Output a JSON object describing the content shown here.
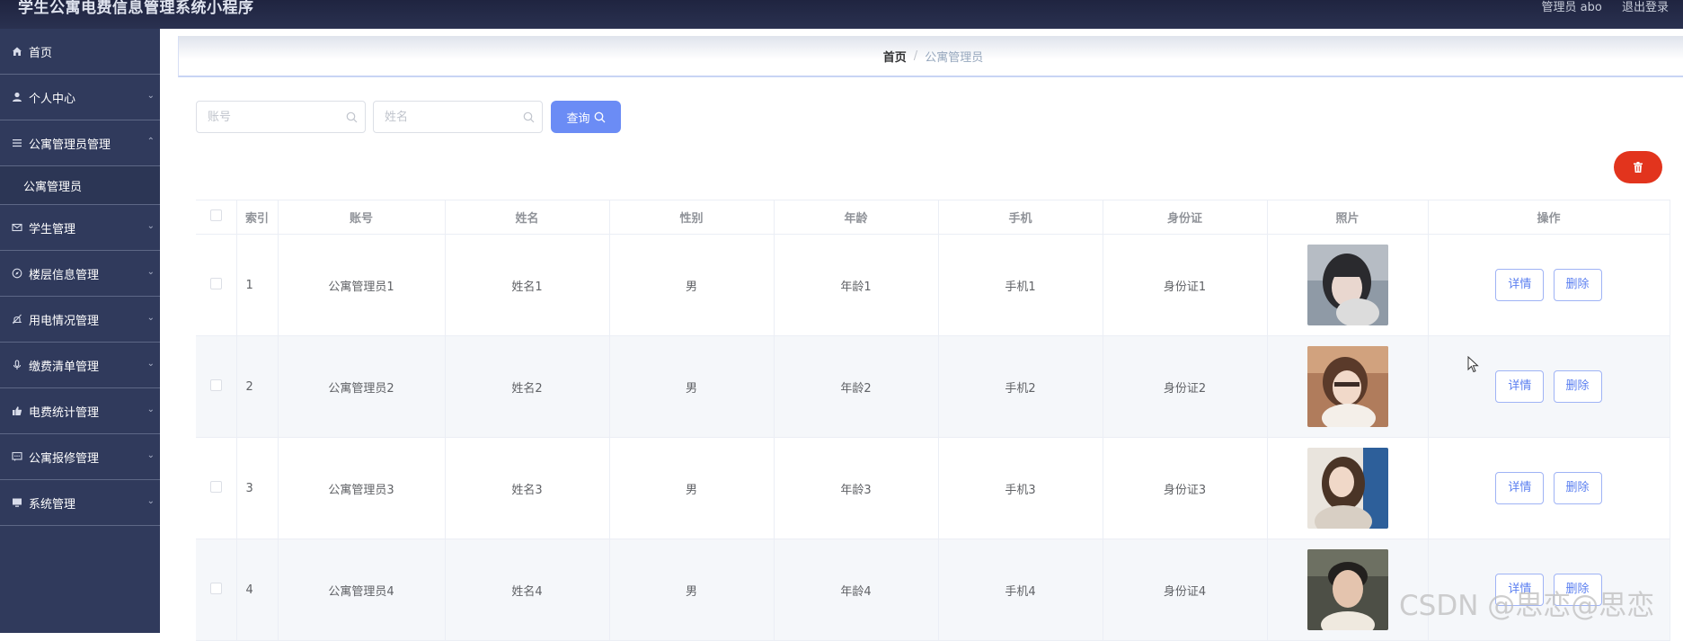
{
  "header": {
    "title": "学生公寓电费信息管理系统小程序",
    "user_label": "管理员 abo",
    "logout_label": "退出登录"
  },
  "sidebar": {
    "items": [
      {
        "label": "首页",
        "icon": "home-icon"
      },
      {
        "label": "个人中心",
        "icon": "user-icon"
      },
      {
        "label": "公寓管理员管理",
        "icon": "menu-icon",
        "sub": "公寓管理员"
      },
      {
        "label": "学生管理",
        "icon": "mail-icon"
      },
      {
        "label": "楼层信息管理",
        "icon": "compass-icon"
      },
      {
        "label": "用电情况管理",
        "icon": "bell-icon"
      },
      {
        "label": "缴费清单管理",
        "icon": "mic-icon"
      },
      {
        "label": "电费统计管理",
        "icon": "thumb-icon"
      },
      {
        "label": "公寓报修管理",
        "icon": "chat-icon"
      },
      {
        "label": "系统管理",
        "icon": "monitor-icon"
      }
    ]
  },
  "breadcrumb": {
    "home": "首页",
    "separator": "/",
    "current": "公寓管理员"
  },
  "search": {
    "account_placeholder": "账号",
    "name_placeholder": "姓名",
    "query_label": "查询"
  },
  "table": {
    "headers": [
      "索引",
      "账号",
      "姓名",
      "性别",
      "年龄",
      "手机",
      "身份证",
      "照片",
      "操作"
    ],
    "rows": [
      {
        "index": "1",
        "account": "公寓管理员1",
        "name": "姓名1",
        "gender": "男",
        "age": "年龄1",
        "phone": "手机1",
        "id_card": "身份证1"
      },
      {
        "index": "2",
        "account": "公寓管理员2",
        "name": "姓名2",
        "gender": "男",
        "age": "年龄2",
        "phone": "手机2",
        "id_card": "身份证2"
      },
      {
        "index": "3",
        "account": "公寓管理员3",
        "name": "姓名3",
        "gender": "男",
        "age": "年龄3",
        "phone": "手机3",
        "id_card": "身份证3"
      },
      {
        "index": "4",
        "account": "公寓管理员4",
        "name": "姓名4",
        "gender": "男",
        "age": "年龄4",
        "phone": "手机4",
        "id_card": "身份证4"
      }
    ],
    "detail_label": "详情",
    "delete_label": "删除"
  },
  "watermark": "CSDN @思恋@思恋",
  "colors": {
    "sidebar_bg": "#303a5c",
    "header_bg": "#1f2440",
    "primary": "#6b8cf5",
    "danger": "#e2341d"
  }
}
